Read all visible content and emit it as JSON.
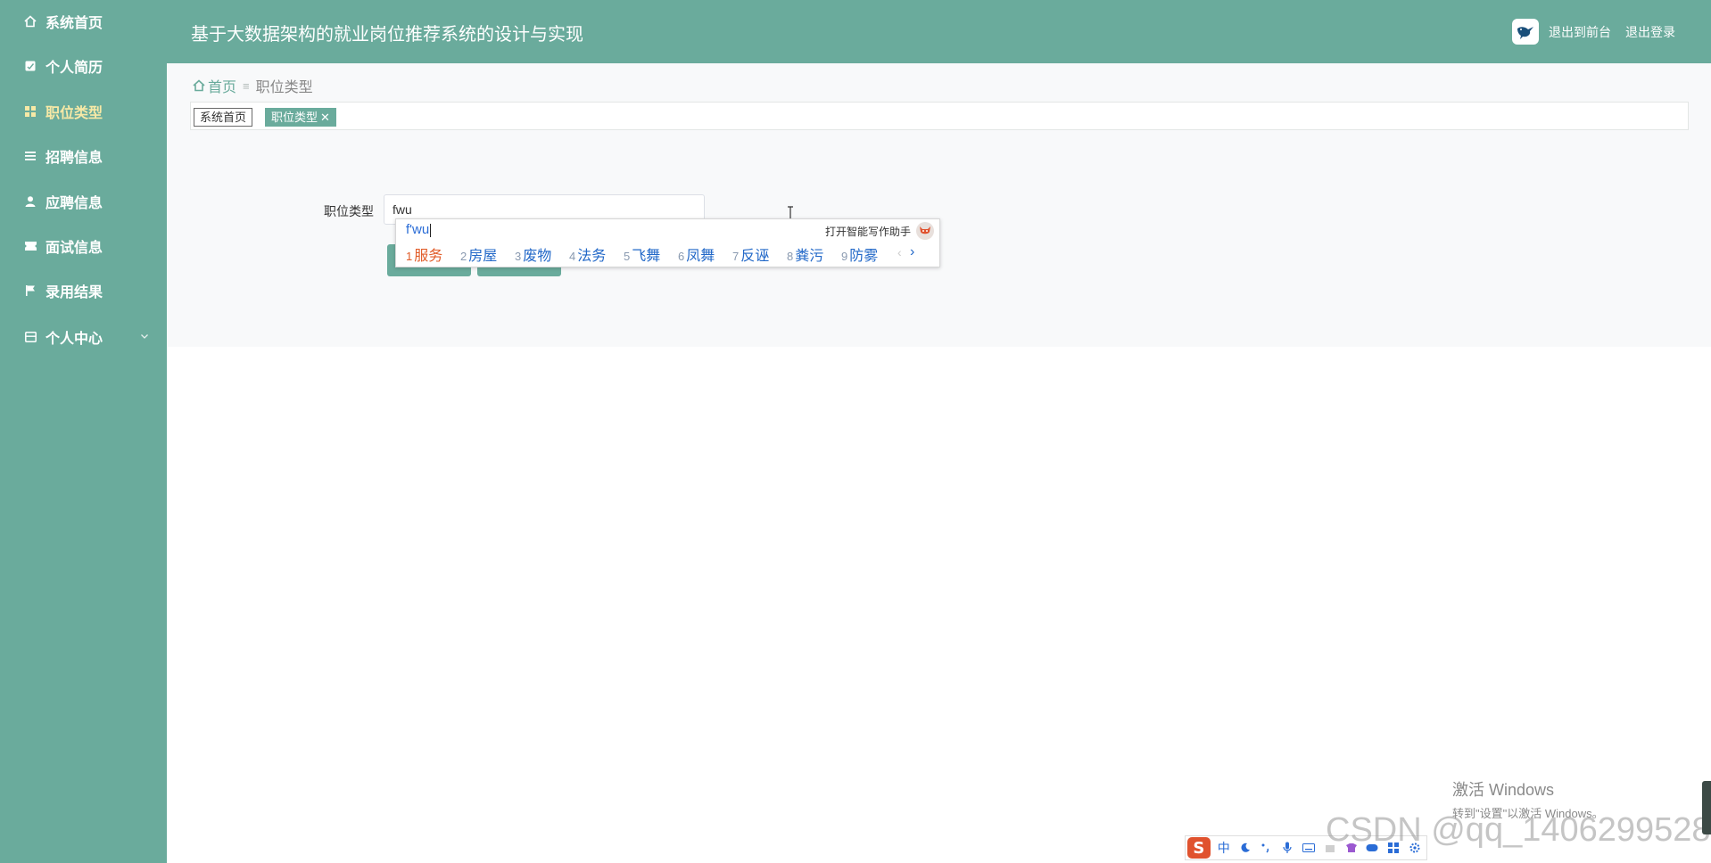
{
  "app": {
    "title": "基于大数据架构的就业岗位推荐系统的设计与实现"
  },
  "sidebar": {
    "items": [
      {
        "label": "系统首页",
        "icon": "home-icon"
      },
      {
        "label": "个人简历",
        "icon": "resume-icon"
      },
      {
        "label": "职位类型",
        "icon": "grid-icon",
        "active": true
      },
      {
        "label": "招聘信息",
        "icon": "list-icon"
      },
      {
        "label": "应聘信息",
        "icon": "user-icon"
      },
      {
        "label": "面试信息",
        "icon": "ticket-icon"
      },
      {
        "label": "录用结果",
        "icon": "flag-icon"
      },
      {
        "label": "个人中心",
        "icon": "panel-icon",
        "expandable": true
      }
    ]
  },
  "header": {
    "back_to_front": "退出到前台",
    "logout": "退出登录"
  },
  "breadcrumb": {
    "home": "首页",
    "separator": "≡",
    "current": "职位类型"
  },
  "tags": [
    {
      "label": "系统首页",
      "active": false
    },
    {
      "label": "职位类型",
      "active": true,
      "close": "✕"
    }
  ],
  "form": {
    "label": "职位类型",
    "value": "fwu"
  },
  "ime": {
    "composition": "f'wu",
    "assistant": "打开智能写作助手",
    "candidates": [
      {
        "num": "1",
        "text": "服务"
      },
      {
        "num": "2",
        "text": "房屋"
      },
      {
        "num": "3",
        "text": "废物"
      },
      {
        "num": "4",
        "text": "法务"
      },
      {
        "num": "5",
        "text": "飞舞"
      },
      {
        "num": "6",
        "text": "凤舞"
      },
      {
        "num": "7",
        "text": "反诬"
      },
      {
        "num": "8",
        "text": "粪污"
      },
      {
        "num": "9",
        "text": "防雾"
      }
    ],
    "prev": "‹",
    "next": "›"
  },
  "imebar": {
    "logo": "S",
    "mode": "中"
  },
  "watermark": {
    "activate_title": "激活 Windows",
    "activate_sub": "转到\"设置\"以激活 Windows。",
    "csdn": "CSDN @qq_1406299528"
  },
  "colors": {
    "primary": "#6aab9c",
    "active_text": "#f7e9a6",
    "candidate_first": "#e15b27",
    "candidate": "#2268c8"
  }
}
